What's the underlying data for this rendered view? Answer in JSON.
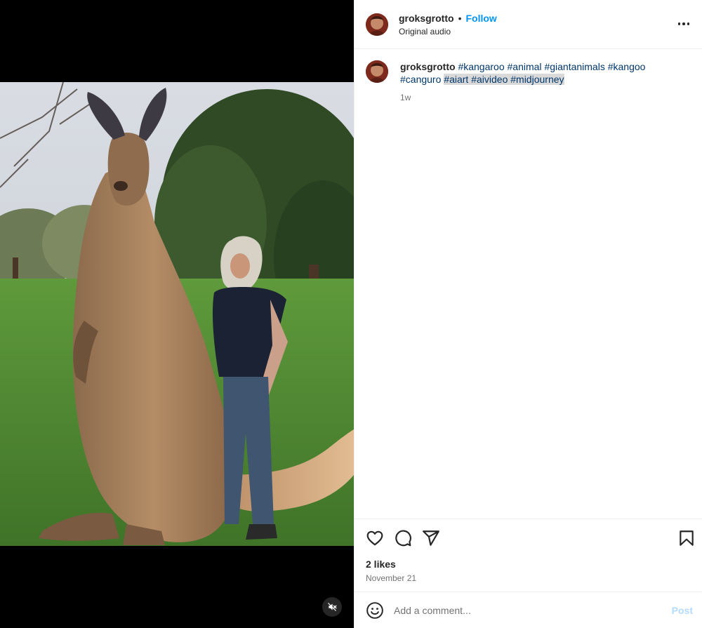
{
  "post": {
    "username": "groksgrotto",
    "header_separator": "•",
    "follow_label": "Follow",
    "audio_label": "Original audio"
  },
  "caption": {
    "username": "groksgrotto",
    "hashtags": [
      "#kangaroo",
      "#animal",
      "#giantanimals",
      "#kangoo",
      "#canguro",
      "#aiart",
      "#aivideo",
      "#midjourney"
    ],
    "highlighted_tags": [
      "#aiart",
      "#aivideo",
      "#midjourney"
    ],
    "age": "1w"
  },
  "actions": {
    "icons": [
      "heart-icon",
      "comment-icon",
      "share-icon",
      "bookmark-icon"
    ],
    "likes": "2 likes",
    "date": "November 21"
  },
  "comment": {
    "placeholder": "Add a comment...",
    "post_label": "Post"
  },
  "media": {
    "mute_icon": "speaker-muted-icon"
  },
  "colors": {
    "accent": "#0095f6",
    "hashtag": "#00376b",
    "post_disabled": "#b3dbff"
  }
}
